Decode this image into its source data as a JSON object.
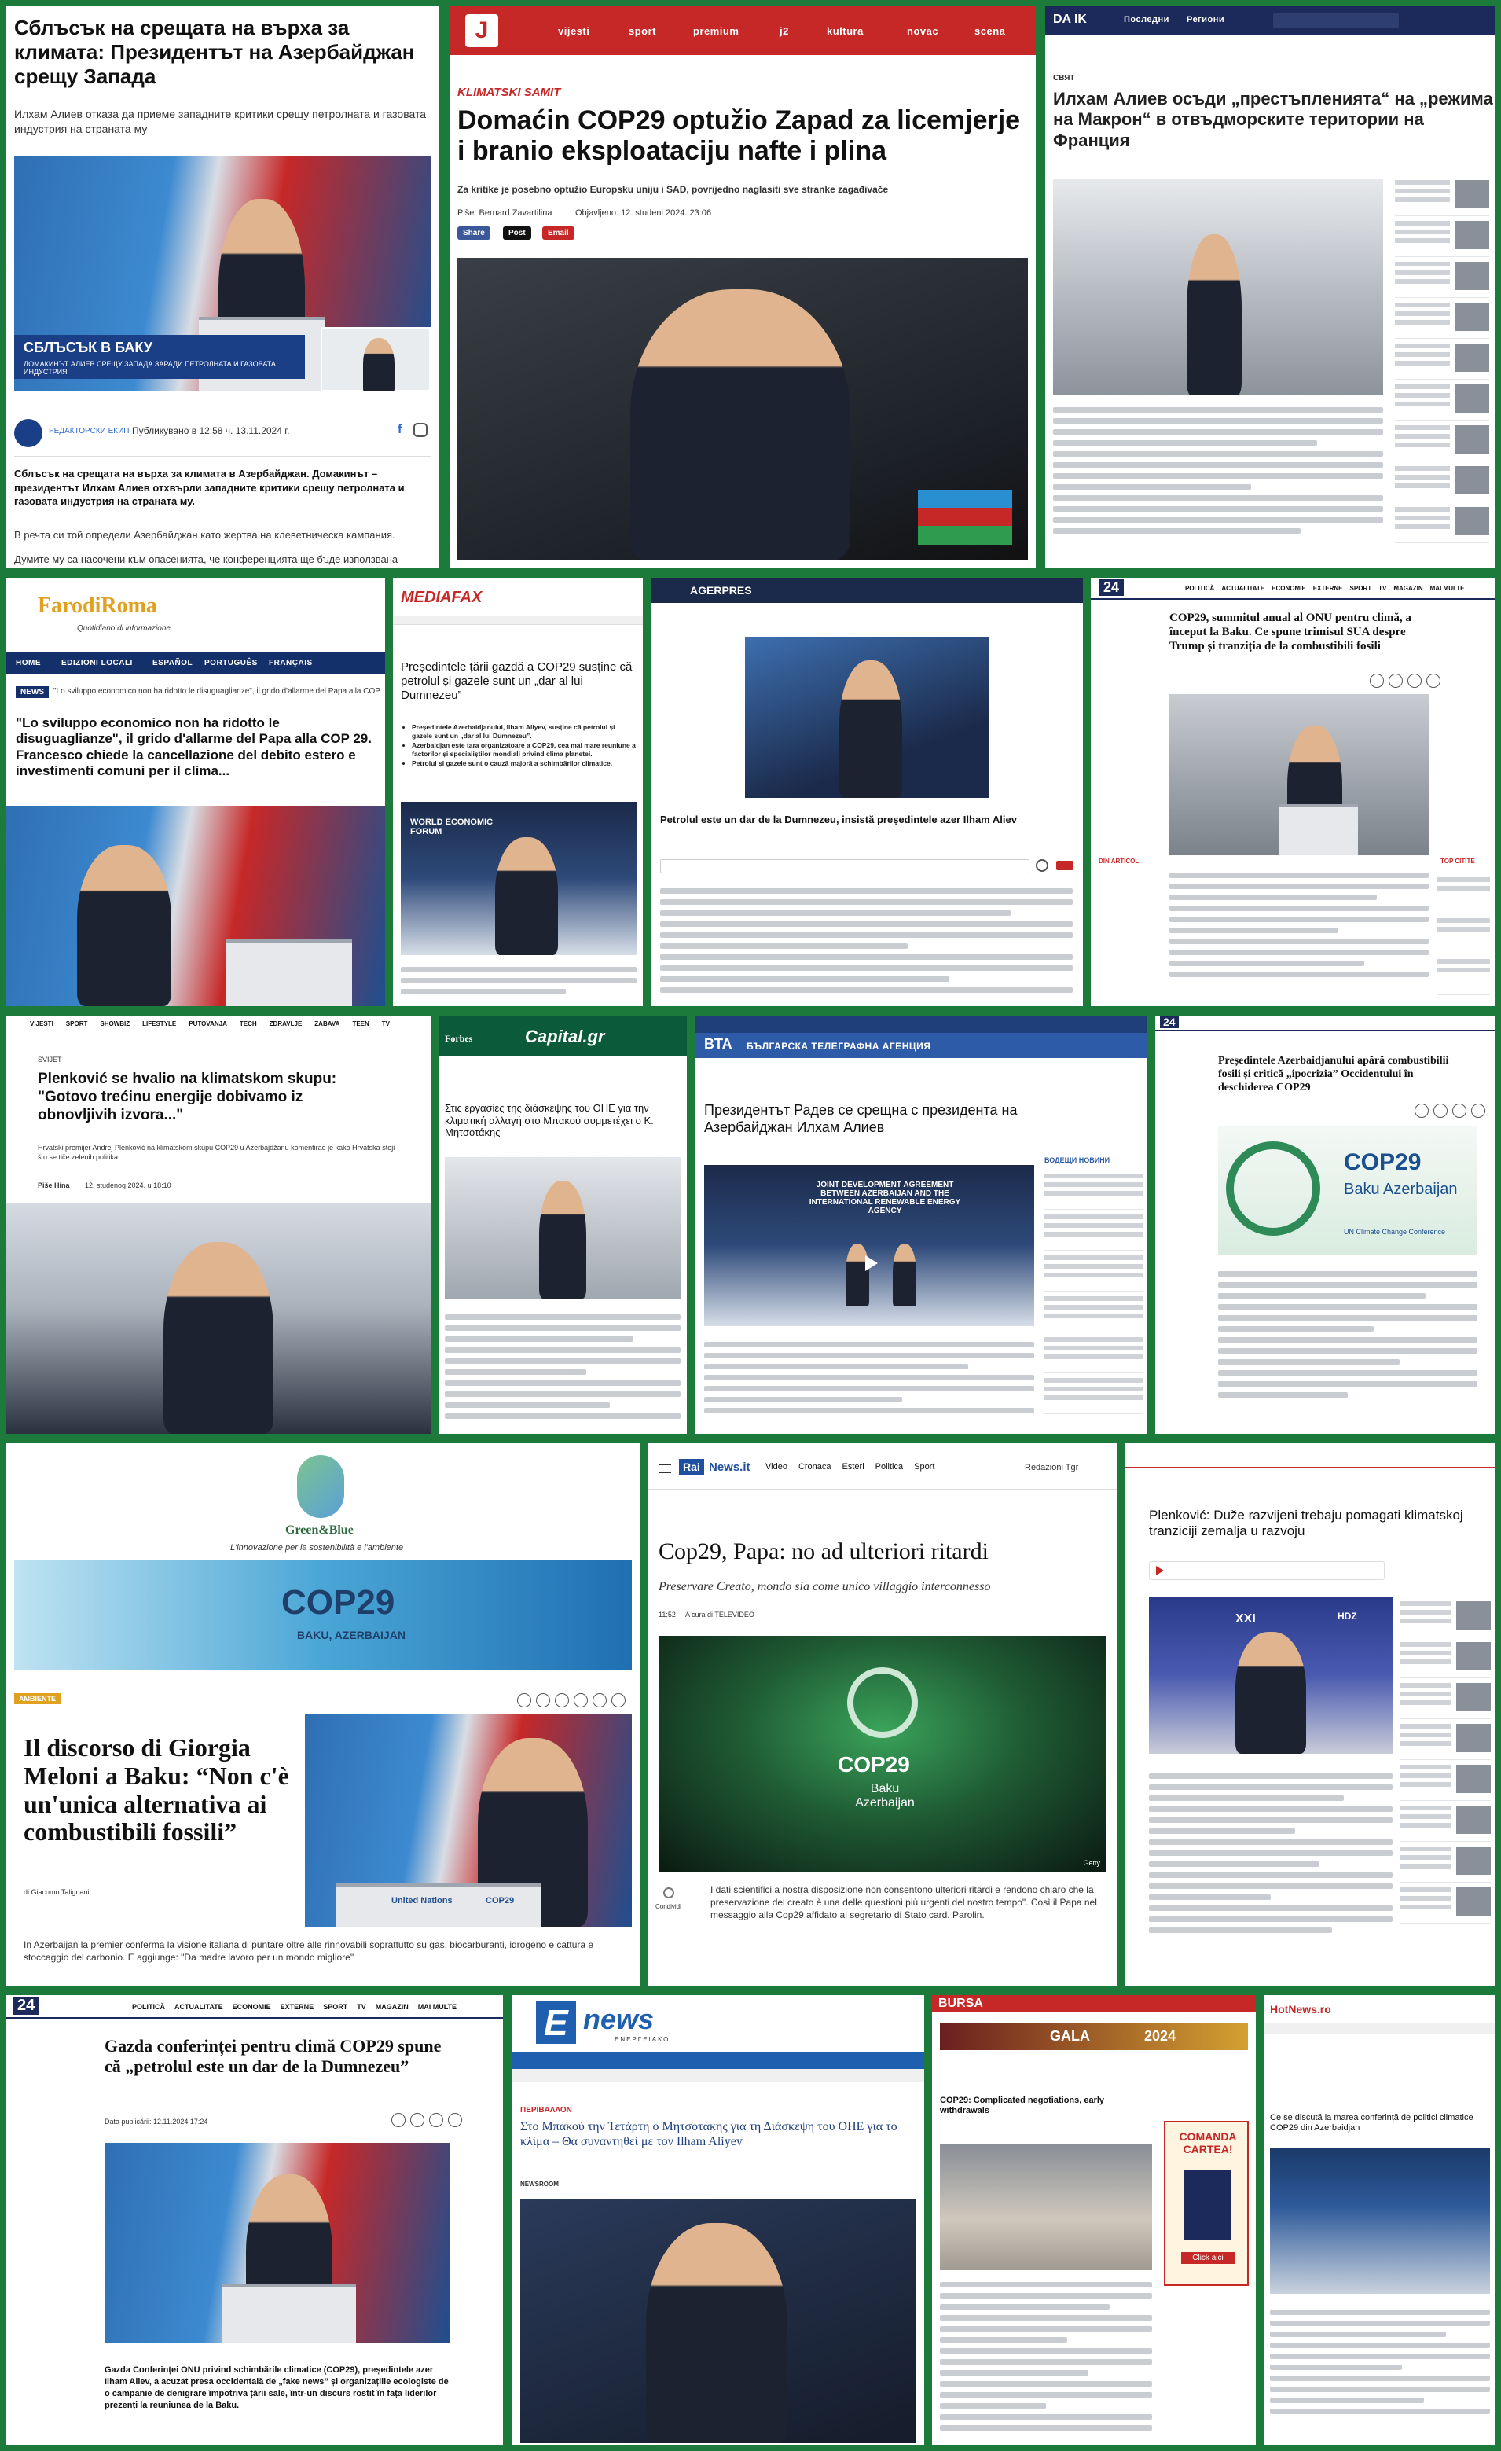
{
  "tiles": {
    "t1": {
      "headline": "Сблъсък на срещата на върха за климата: Президентът на Азербайджан срещу Запада",
      "sub": "Илхам Алиев отказа да приеме западните критики срещу петролната и газовата индустрия на страната му",
      "lower_title": "СБЛЪСЪК В БАКУ",
      "lower_sub": "ДОМАКИНЪТ АЛИЕВ СРЕЩУ ЗАПАДА ЗАРАДИ ПЕТРОЛНАТА И ГАЗОВАТА ИНДУСТРИЯ",
      "author_label": "РЕДАКТОРСКИ ЕКИП",
      "published": "Публикувано в 12:58 ч. 13.11.2024 г.",
      "lead": "Сблъсък на срещата на върха за климата в Азербайджан. Домакинът – президентът Илхам Алиев отхвърли западните критики срещу петролната и газовата индустрия на страната му.",
      "para1": "В речта си той определи Азербайджан като жертва на клеветническа кампания.",
      "para2": "Думите му са насочени към опасенията, че конференцията ще бъде използвана"
    },
    "t2": {
      "logo": "J",
      "nav": [
        "vijesti",
        "sport",
        "premium",
        "j2",
        "kultura",
        "novac",
        "scena"
      ],
      "kicker": "KLIMATSKI SAMIT",
      "headline": "Domaćin COP29 optužio Zapad za licemjerje i branio eksploataciju nafte i plina",
      "sub": "Za kritike je posebno optužio Europsku uniju i SAD, povrijedno naglasiti sve stranke zagađivače",
      "byline": "Piše: Bernard Zavartilina",
      "date": "Objavljeno: 12. studeni 2024. 23:06",
      "share": [
        "Share",
        "Post",
        "Email"
      ]
    },
    "t3": {
      "logo": "DA IK",
      "nav": [
        "Последни",
        "Региони"
      ],
      "kicker": "СВЯТ",
      "headline": "Илхам Алиев осъди „престъпленията“ на „режима на Макрон“ в отвъдморските територии на Франция"
    },
    "t4": {
      "logo": "FarodiRoma",
      "tagline": "Quotidiano di informazione",
      "nav": [
        "HOME",
        "EDIZIONI LOCALI",
        "ESPAÑOL",
        "PORTUGUÊS",
        "FRANÇAIS"
      ],
      "ticker_label": "NEWS",
      "ticker": "\"Lo sviluppo economico non ha ridotto le disuguaglianze\", il grido d'allarme del Papa alla COP",
      "headline": "\"Lo sviluppo economico non ha ridotto le disuguaglianze\", il grido d'allarme del Papa alla COP 29. Francesco chiede la cancellazione del debito estero e investimenti comuni per il clima..."
    },
    "t5": {
      "logo": "MEDIAFAX",
      "headline": "Președintele țării gazdă a COP29 susține că petrolul și gazele sunt un „dar al lui Dumnezeu”",
      "bullets": [
        "Președintele Azerbaidjanului, Ilham Aliyev, susține că petrolul și gazele sunt un „dar al lui Dumnezeu”.",
        "Azerbaidjan este țara organizatoare a COP29, cea mai mare reuniune a factorilor și specialiștilor mondiali privind clima planetei.",
        "Petrolul și gazele sunt o cauză majoră a schimbărilor climatice."
      ],
      "backdrop": "WORLD ECONOMIC FORUM"
    },
    "t6": {
      "logo": "AGERPRES",
      "headline": "Petrolul este un dar de la Dumnezeu, insistă președintele azer Ilham Aliev"
    },
    "t7": {
      "logo": "24",
      "nav": [
        "POLITICĂ",
        "ACTUALITATE",
        "ECONOMIE",
        "EXTERNE",
        "SPORT",
        "TV",
        "MAGAZIN",
        "MAI MULTE"
      ],
      "headline": "COP29, summitul anual al ONU pentru climă, a început la Baku. Ce spune trimisul SUA despre Trump și tranziția de la combustibili fosili",
      "side_left": "DIN ARTICOL",
      "side_right": "TOP CITITE"
    },
    "t8": {
      "nav": [
        "VIJESTI",
        "SPORT",
        "SHOWBIZ",
        "LIFESTYLE",
        "PUTOVANJA",
        "TECH",
        "ZDRAVLJE",
        "ZABAVA",
        "TEEN",
        "TV"
      ],
      "section": "SVIJET",
      "headline": "Plenković se hvalio na klimatskom skupu: \"Gotovo trećinu energije dobivamo iz obnovljivih izvora...\"",
      "sub": "Hrvatski premijer Andrej Plenković na klimatskom skupu COP29 u Azerbajdžanu komentirao je kako Hrvatska stoji što se tiče zelenih politika",
      "byline": "Piše Hina",
      "date": "12. studenog 2024. u 18:10"
    },
    "t9": {
      "logo_left": "Forbes",
      "logo": "Capital.gr",
      "headline": "Στις εργασίες της διάσκεψης του ΟΗΕ για την κλιματική αλλαγή στο Μπακού συμμετέχει ο Κ. Μητσοτάκης"
    },
    "t10": {
      "logo": "BTA",
      "agency": "БЪЛГАРСКА ТЕЛЕГРАФНА АГЕНЦИЯ",
      "headline": "Президентът Радев се срещна с президента на Азербайджан Илхам Алиев",
      "screen": "JOINT DEVELOPMENT AGREEMENT BETWEEN AZERBAIJAN AND THE INTERNATIONAL RENEWABLE ENERGY AGENCY",
      "side": "ВОДЕЩИ НОВИНИ"
    },
    "t11": {
      "logo": "24",
      "headline": "Președintele Azerbaidjanului apără combustibilii fosili și critică „ipocrizia” Occidentului în deschiderea COP29",
      "banner": "COP29",
      "banner_sub": "Baku Azerbaijan",
      "banner_sub2": "UN Climate Change Conference"
    },
    "t12": {
      "logo": "Green&Blue",
      "tagline": "L'innovazione per la sostenibilità e l'ambiente",
      "banner": "COP29",
      "banner_sub": "BAKU, AZERBAIJAN",
      "tag": "AMBIENTE",
      "headline": "Il discorso di Giorgia Meloni a Baku: “Non c'è un'unica alternativa ai combustibili fossili”",
      "byline": "di Giacomo Talignani",
      "lead": "In Azerbaijan la premier conferma la visione italiana di puntare oltre alle rinnovabili soprattutto su gas, biocarburanti, idrogeno e cattura e stoccaggio del carbonio. E aggiunge: \"Da madre lavoro per un mondo migliore\"",
      "lectern": "United Nations",
      "lectern_cop": "COP29"
    },
    "t13": {
      "logo": "Rai",
      "logo2": "News.it",
      "nav": [
        "Video",
        "Cronaca",
        "Esteri",
        "Politica",
        "Sport"
      ],
      "nav_right": "Redazioni Tgr",
      "headline": "Cop29, Papa: no ad ulteriori ritardi",
      "sub": "Preservare Creato, mondo sia come unico villaggio interconnesso",
      "time": "11:52",
      "source": "A cura di TELEVIDEO",
      "stage_text": "COP29",
      "stage_sub": "Baku Azerbaijan",
      "credit": "Getty",
      "share": "Condividi",
      "quote": "I dati scientifici a nostra disposizione non consentono ulteriori ritardi e rendono chiaro che la preservazione del creato è una delle questioni più urgenti del nostro tempo\". Così il Papa nel messaggio alla Cop29 affidato al segretario di Stato card. Parolin."
    },
    "t14": {
      "headline": "Plenković: Duže razvijeni trebaju pomagati klimatskoj tranziciji zemalja u razvoju",
      "backdrop": "XXI",
      "backdrop2": "HDZ"
    },
    "t15": {
      "logo": "24",
      "nav": [
        "POLITICĂ",
        "ACTUALITATE",
        "ECONOMIE",
        "EXTERNE",
        "SPORT",
        "TV",
        "MAGAZIN",
        "MAI MULTE"
      ],
      "headline": "Gazda conferinței pentru climă COP29 spune că „petrolul este un dar de la Dumnezeu”",
      "date": "Data publicării: 12.11.2024 17:24",
      "lead": "Gazda Conferinței ONU privind schimbările climatice (COP29), președintele azer Ilham Aliev, a acuzat presa occidentală de „fake news” și organizațiile ecologiste de o campanie de denigrare împotriva țării sale, într-un discurs rostit în fața liderilor prezenți la reuniunea de la Baku."
    },
    "t16": {
      "logo": "E",
      "logo2": "news",
      "tagline": "ΕΝΕΡΓΕΙΑΚΟ",
      "kicker": "ΠΕΡΙΒΑΛΛΟΝ",
      "headline": "Στο Μπακού την Τετάρτη ο Μητσοτάκης για τη Διάσκεψη του ΟΗΕ για το κλίμα – Θα συναντηθεί με τον Ilham Aliyev",
      "section": "NEWSROOM"
    },
    "t17": {
      "logo": "BURSA",
      "promo": "GALA",
      "promo_year": "2024",
      "headline": "COP29: Complicated negotiations, early withdrawals",
      "ad_title": "COMANDA CARTEA!",
      "ad_sub": "Click aici"
    },
    "t18": {
      "logo": "HotNews.ro",
      "headline": "Ce se discută la marea conferință de politici climatice COP29 din Azerbaidjan"
    }
  }
}
